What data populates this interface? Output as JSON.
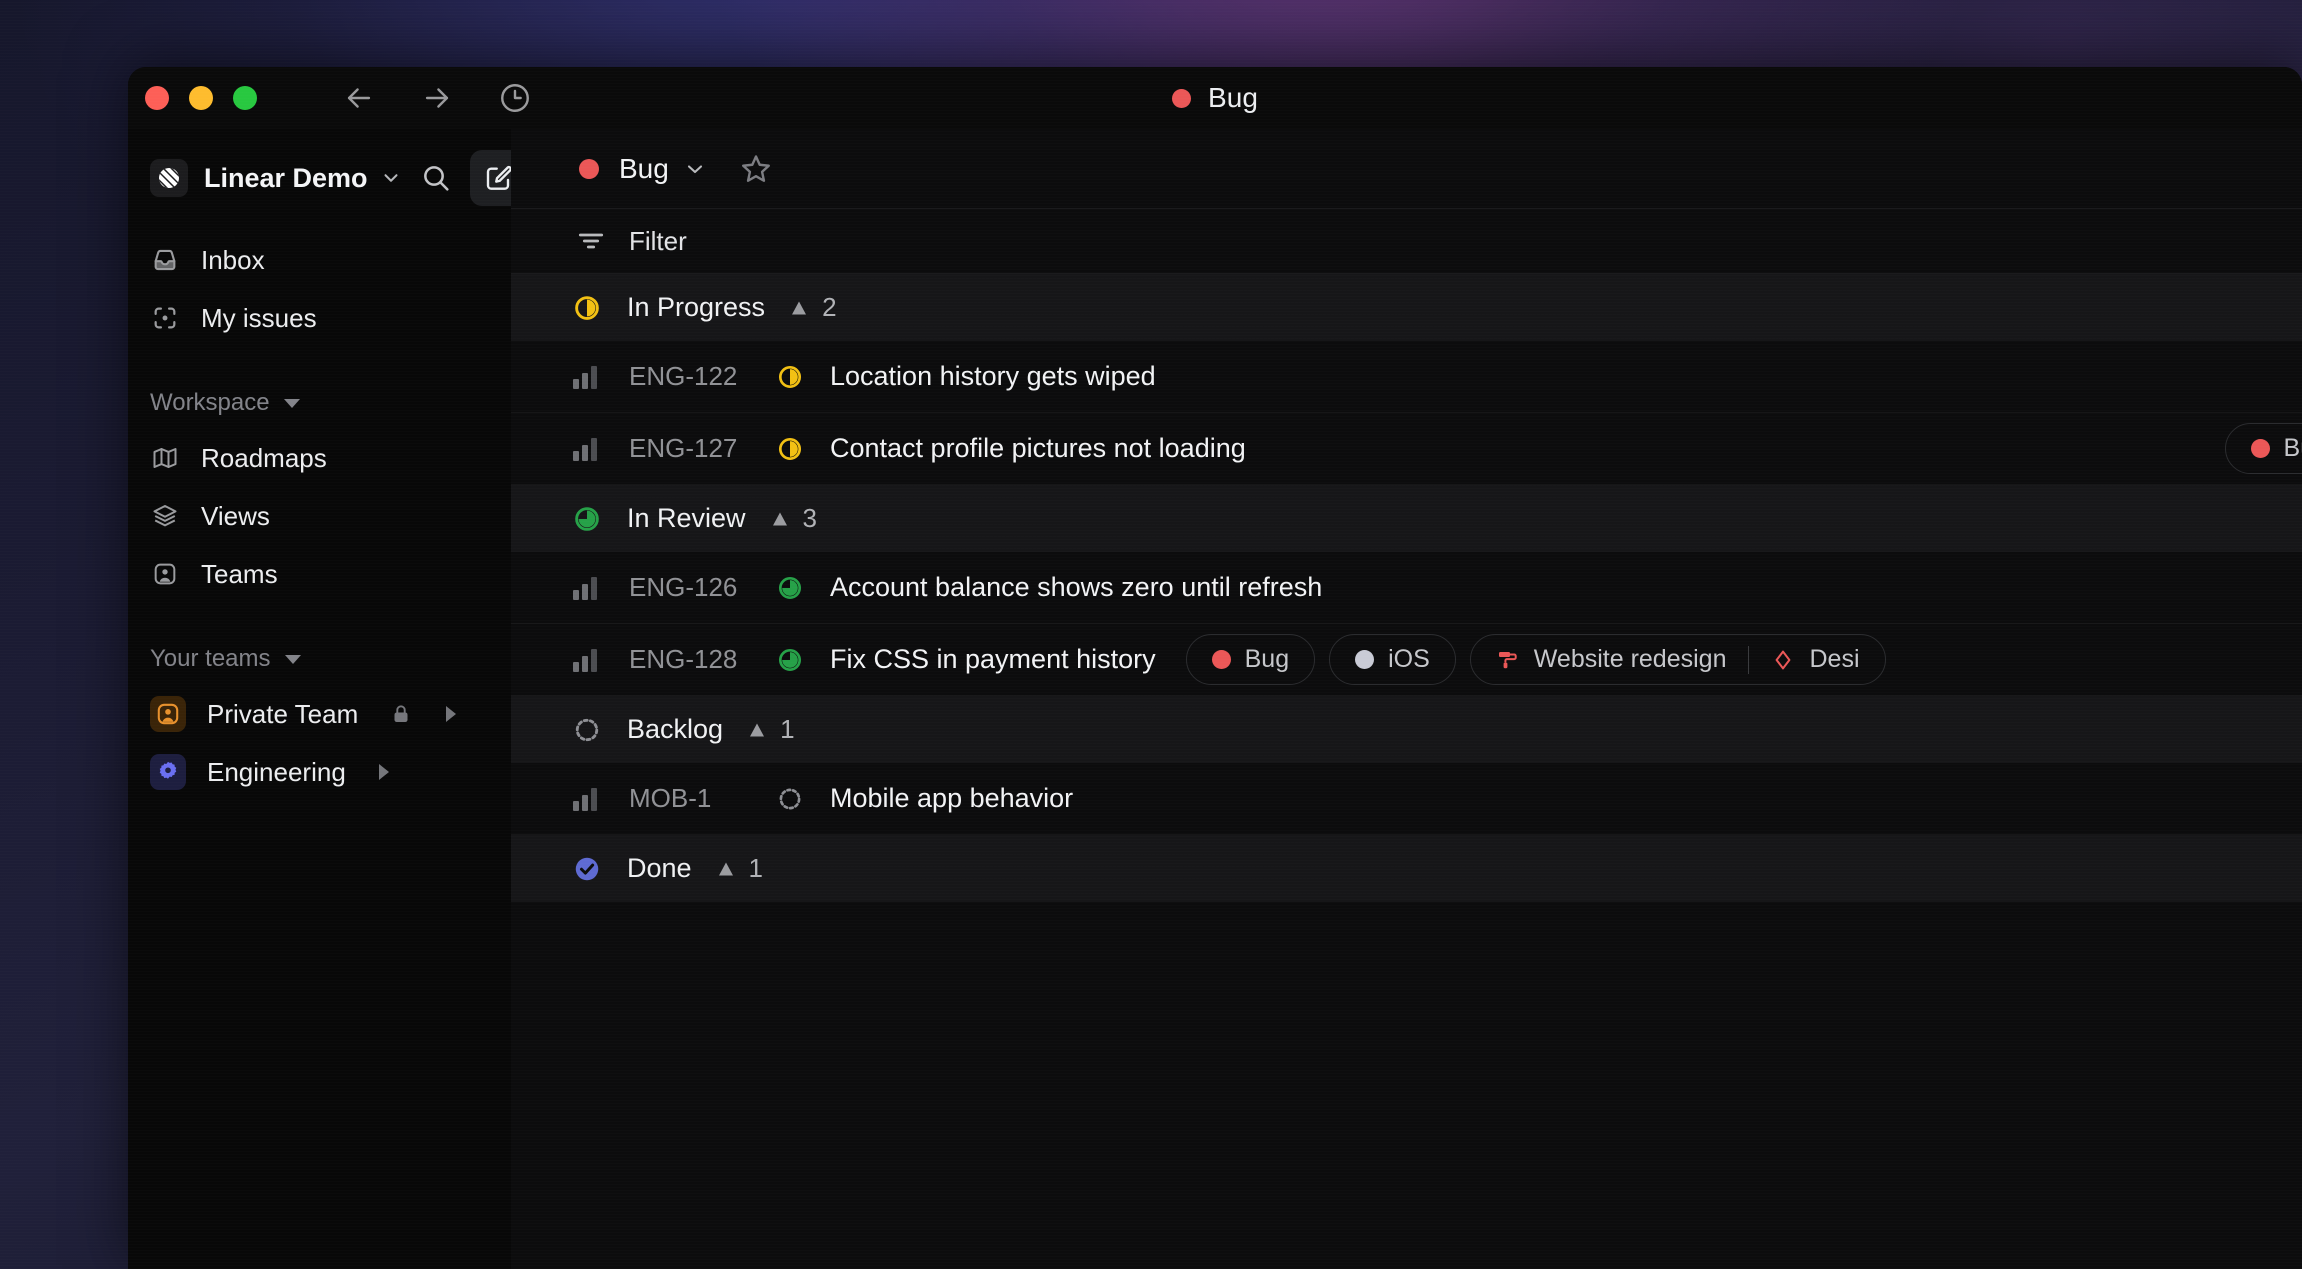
{
  "window": {
    "titlebar": {
      "center_label": "Bug",
      "center_dot_color": "#eb5757",
      "back_icon": "arrow-left-icon",
      "forward_icon": "arrow-right-icon",
      "history_icon": "clock-icon"
    }
  },
  "sidebar": {
    "workspace": {
      "name": "Linear Demo",
      "chevron_icon": "chevron-down-icon",
      "search_icon": "search-icon",
      "compose_icon": "compose-icon"
    },
    "nav": [
      {
        "label": "Inbox",
        "icon": "inbox-icon"
      },
      {
        "label": "My issues",
        "icon": "my-issues-icon"
      }
    ],
    "workspace_section": {
      "title": "Workspace",
      "items": [
        {
          "label": "Roadmaps",
          "icon": "map-icon"
        },
        {
          "label": "Views",
          "icon": "layers-icon"
        },
        {
          "label": "Teams",
          "icon": "teams-icon"
        }
      ]
    },
    "teams_section": {
      "title": "Your teams",
      "items": [
        {
          "label": "Private Team",
          "icon": "team-avatar-icon",
          "icon_color": "#e8912d",
          "private": true,
          "lock_icon": "lock-icon",
          "expand_icon": "caret-right-icon"
        },
        {
          "label": "Engineering",
          "icon": "gear-icon",
          "icon_color": "#6a6ff0",
          "private": false,
          "expand_icon": "caret-right-icon"
        }
      ]
    }
  },
  "main": {
    "header": {
      "title": "Bug",
      "dot_color": "#eb5757",
      "chevron_icon": "chevron-down-icon",
      "favorite_icon": "star-icon"
    },
    "filter": {
      "label": "Filter",
      "icon": "filter-icon"
    },
    "groups": [
      {
        "name": "In Progress",
        "status_icon": "in-progress-icon",
        "status_color": "#f2c013",
        "count": "2",
        "priority_icon": "triangle-icon",
        "issues": [
          {
            "id": "ENG-122",
            "title": "Location history gets wiped",
            "status_icon": "in-progress-icon",
            "status_color": "#f2c013",
            "priority_icon": "priority-bars-icon",
            "labels": []
          },
          {
            "id": "ENG-127",
            "title": "Contact profile pictures not loading",
            "status_icon": "in-progress-icon",
            "status_color": "#f2c013",
            "priority_icon": "priority-bars-icon",
            "labels": [
              {
                "text": "Bug",
                "dot_color": "#eb5757",
                "clipped": true
              }
            ]
          }
        ]
      },
      {
        "name": "In Review",
        "status_icon": "in-review-icon",
        "status_color": "#26a148",
        "count": "3",
        "priority_icon": "triangle-icon",
        "issues": [
          {
            "id": "ENG-126",
            "title": "Account balance shows zero until refresh",
            "status_icon": "in-review-icon",
            "status_color": "#26a148",
            "priority_icon": "priority-bars-icon",
            "labels": []
          },
          {
            "id": "ENG-128",
            "title": "Fix CSS in payment history",
            "status_icon": "in-review-icon",
            "status_color": "#26a148",
            "priority_icon": "priority-bars-icon",
            "labels": [
              {
                "text": "Bug",
                "dot_color": "#eb5757"
              },
              {
                "text": "iOS",
                "dot_color": "#c9cbd6"
              },
              {
                "text": "Website redesign",
                "icon": "paint-roller-icon",
                "icon_color": "#eb5757",
                "second_text": "Desi",
                "second_icon": "diamond-icon",
                "second_icon_color": "#eb5757"
              }
            ]
          }
        ]
      },
      {
        "name": "Backlog",
        "status_icon": "backlog-icon",
        "status_color": "#8e8f94",
        "count": "1",
        "priority_icon": "triangle-icon",
        "issues": [
          {
            "id": "MOB-1",
            "title": "Mobile app behavior",
            "status_icon": "backlog-icon",
            "status_color": "#8e8f94",
            "priority_icon": "priority-bars-icon",
            "labels": []
          }
        ]
      },
      {
        "name": "Done",
        "status_icon": "done-icon",
        "status_color": "#5e6ad2",
        "count": "1",
        "priority_icon": "triangle-icon",
        "issues": []
      }
    ]
  }
}
